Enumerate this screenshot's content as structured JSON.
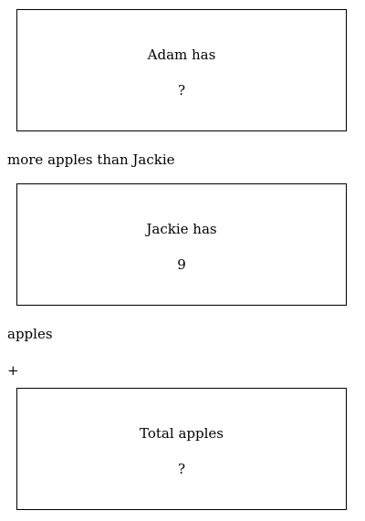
{
  "boxes": {
    "adam": {
      "label": "Adam has",
      "value": "?"
    },
    "jackie": {
      "label": "Jackie has",
      "value": "9"
    },
    "total": {
      "label": "Total apples",
      "value": "?"
    }
  },
  "connectors": {
    "comparison": "more apples than Jackie",
    "unit": "apples",
    "operator": "+"
  }
}
